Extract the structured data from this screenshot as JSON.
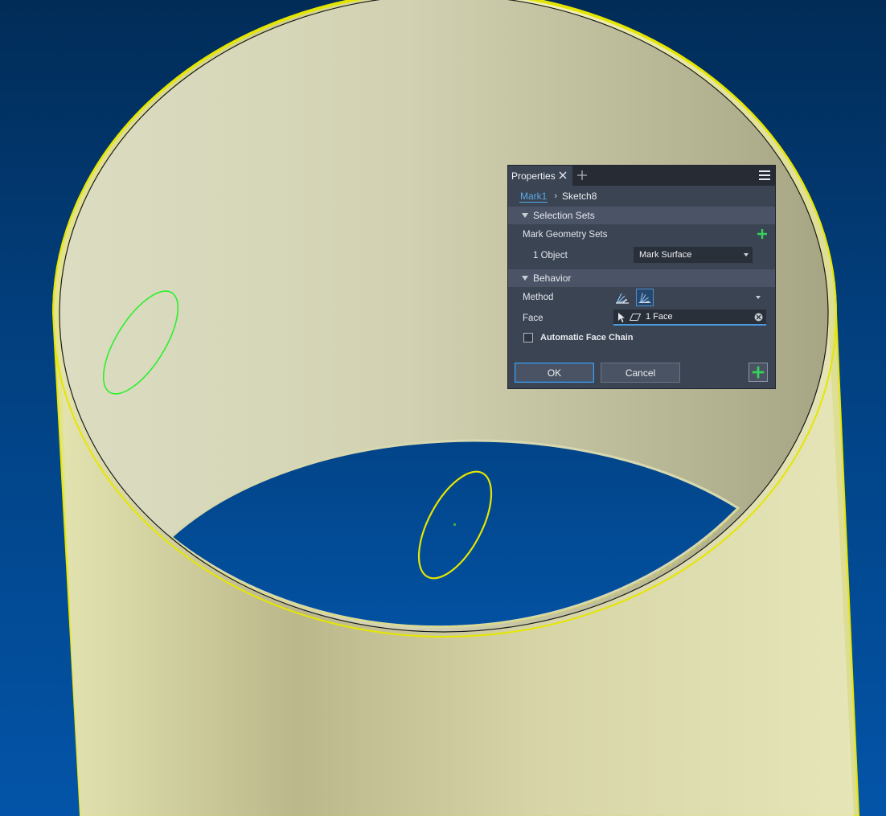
{
  "panel": {
    "tab_title": "Properties",
    "breadcrumb": {
      "parent": "Mark1",
      "current": "Sketch8"
    },
    "sections": {
      "selection_sets": {
        "title": "Selection Sets",
        "mark_geometry_label": "Mark Geometry Sets",
        "object_count": "1 Object",
        "dropdown_value": "Mark Surface"
      },
      "behavior": {
        "title": "Behavior",
        "method_label": "Method",
        "face_label": "Face",
        "face_value": "1 Face",
        "auto_chain_label": "Automatic Face Chain",
        "auto_chain_checked": false
      }
    },
    "buttons": {
      "ok": "OK",
      "cancel": "Cancel"
    }
  },
  "viewport": {
    "background_top": "#012c57",
    "background_bottom": "#0354a8",
    "selection_highlight": "#e6e600",
    "sketch_color": "#2cf02c"
  }
}
